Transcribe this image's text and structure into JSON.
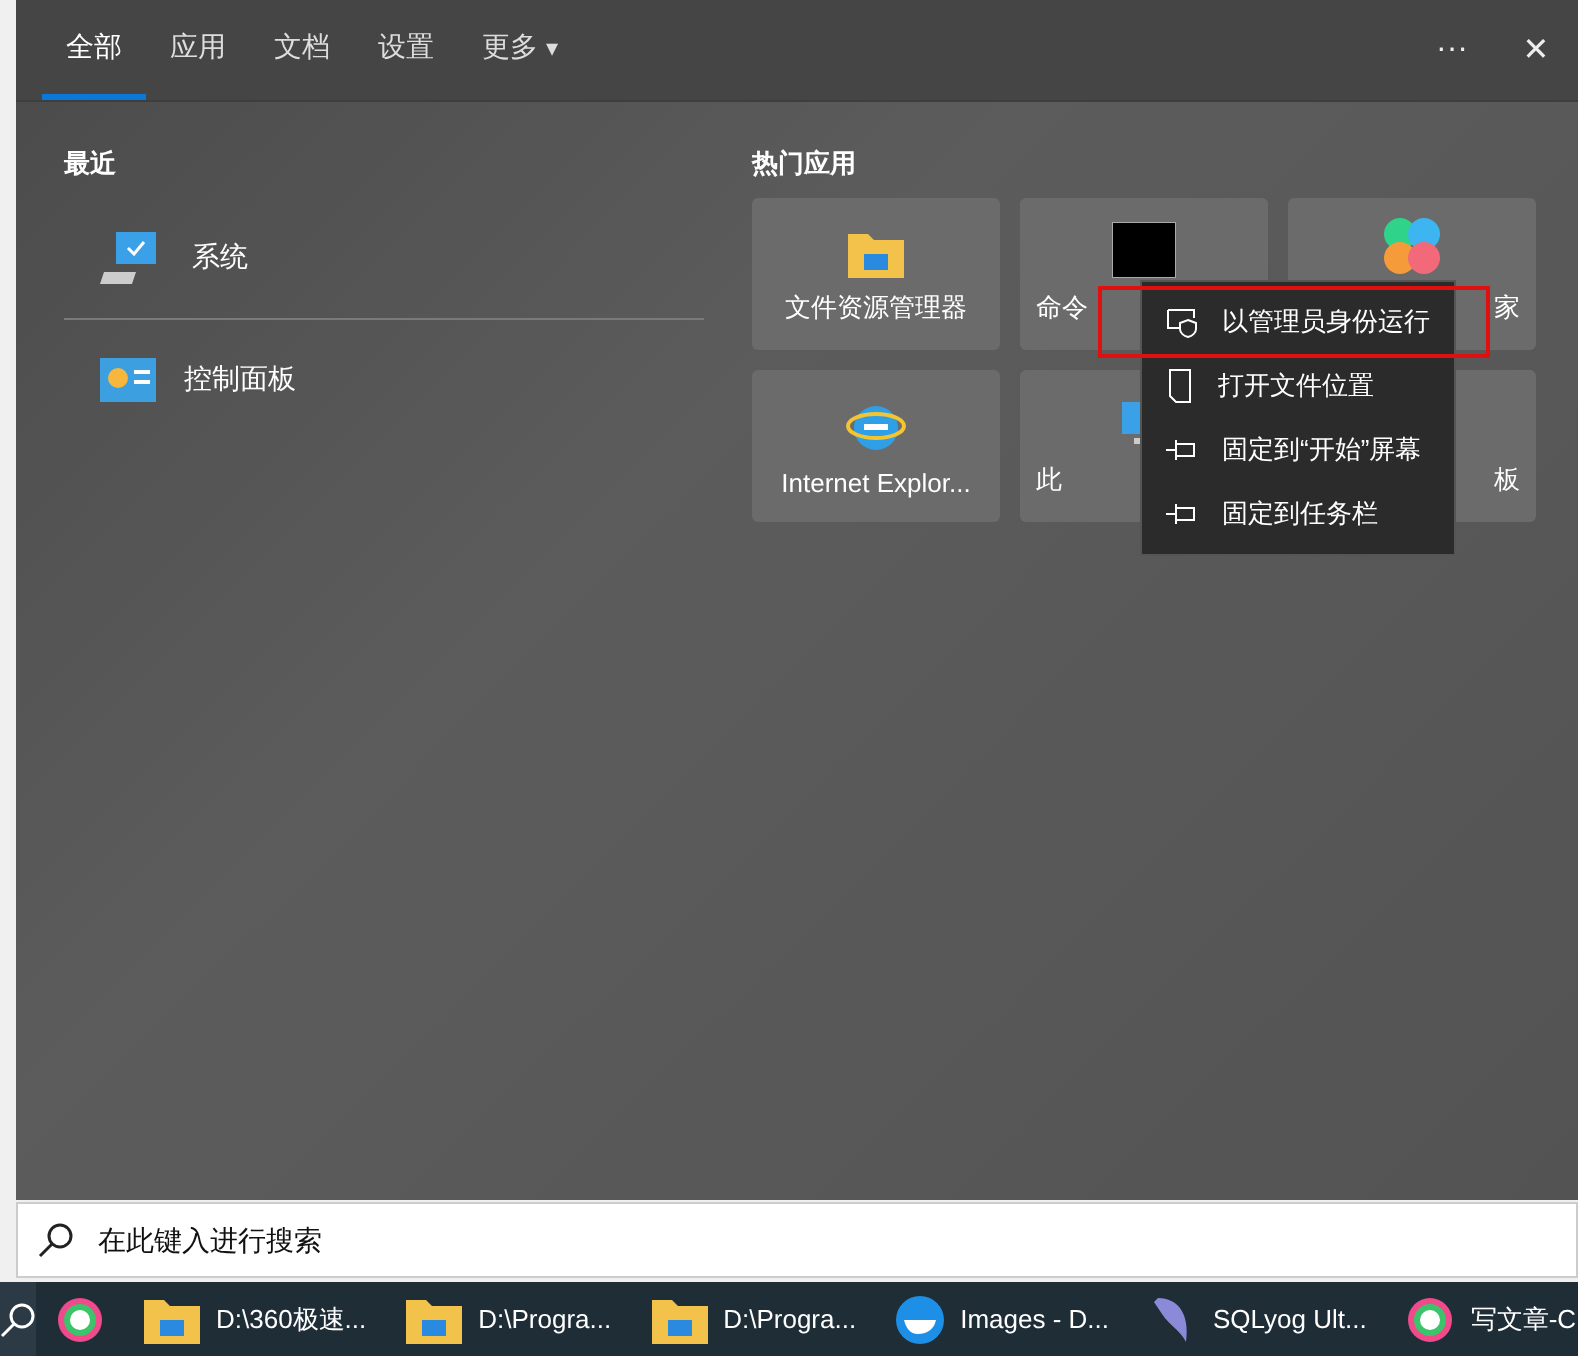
{
  "tabs": [
    {
      "label": "全部",
      "selected": true
    },
    {
      "label": "应用",
      "selected": false
    },
    {
      "label": "文档",
      "selected": false
    },
    {
      "label": "设置",
      "selected": false
    },
    {
      "label": "更多",
      "selected": false,
      "caret": "▾"
    }
  ],
  "window_buttons": [
    "···",
    "✕"
  ],
  "recent": {
    "title": "最近",
    "items": [
      {
        "label": "系统"
      },
      {
        "label": "控制面板"
      }
    ]
  },
  "top_apps": {
    "title": "热门应用",
    "tiles": [
      {
        "label": "文件资源管理器"
      },
      {
        "label": "命令"
      },
      {
        "label": "家"
      },
      {
        "label": "Internet Explor..."
      },
      {
        "label": "此"
      },
      {
        "label": "板"
      }
    ]
  },
  "context_menu": {
    "items": [
      {
        "label": "以管理员身份运行",
        "highlighted": true
      },
      {
        "label": "打开文件位置",
        "highlighted": false
      },
      {
        "label": "固定到“开始”屏幕",
        "highlighted": false
      },
      {
        "label": "固定到任务栏",
        "highlighted": false
      }
    ]
  },
  "search": {
    "placeholder": "在此键入进行搜索"
  },
  "taskbar": [
    {
      "label": "D:\\360极速..."
    },
    {
      "label": "D:\\Progra..."
    },
    {
      "label": "D:\\Progra..."
    },
    {
      "label": "Images - D..."
    },
    {
      "label": "SQLyog Ult..."
    },
    {
      "label": "写文章-C"
    }
  ]
}
